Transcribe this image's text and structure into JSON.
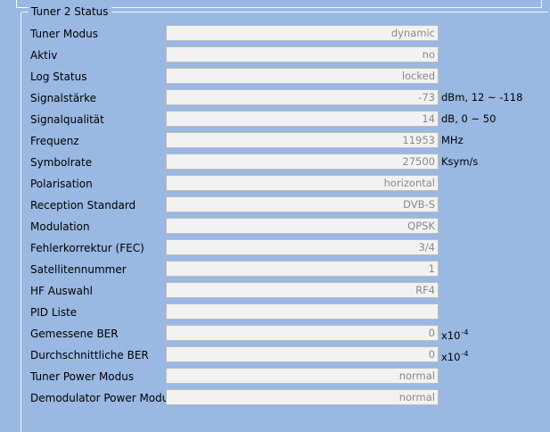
{
  "section": {
    "legend": "Tuner 2 Status"
  },
  "rows": [
    {
      "label": "Tuner Modus",
      "value": "dynamic",
      "unit": ""
    },
    {
      "label": "Aktiv",
      "value": "no",
      "unit": ""
    },
    {
      "label": "Log Status",
      "value": "locked",
      "unit": ""
    },
    {
      "label": "Signalstärke",
      "value": "-73",
      "unit": "dBm, 12 ~ -118"
    },
    {
      "label": "Signalqualität",
      "value": "14",
      "unit": "dB, 0 ~ 50"
    },
    {
      "label": "Frequenz",
      "value": "11953",
      "unit": "MHz"
    },
    {
      "label": "Symbolrate",
      "value": "27500",
      "unit": "Ksym/s"
    },
    {
      "label": "Polarisation",
      "value": "horizontal",
      "unit": ""
    },
    {
      "label": "Reception Standard",
      "value": "DVB-S",
      "unit": ""
    },
    {
      "label": "Modulation",
      "value": "QPSK",
      "unit": ""
    },
    {
      "label": "Fehlerkorrektur (FEC)",
      "value": "3/4",
      "unit": ""
    },
    {
      "label": "Satellitennummer",
      "value": "1",
      "unit": ""
    },
    {
      "label": "HF Auswahl",
      "value": "RF4",
      "unit": ""
    },
    {
      "label": "PID Liste",
      "value": "",
      "unit": ""
    },
    {
      "label": "Gemessene BER",
      "value": "0",
      "unit": "x10",
      "unit_exp": "-4"
    },
    {
      "label": "Durchschnittliche BER",
      "value": "0",
      "unit": "x10",
      "unit_exp": "-4"
    },
    {
      "label": "Tuner Power Modus",
      "value": "normal",
      "unit": ""
    },
    {
      "label": "Demodulator Power Modus",
      "value": "normal",
      "unit": ""
    }
  ]
}
